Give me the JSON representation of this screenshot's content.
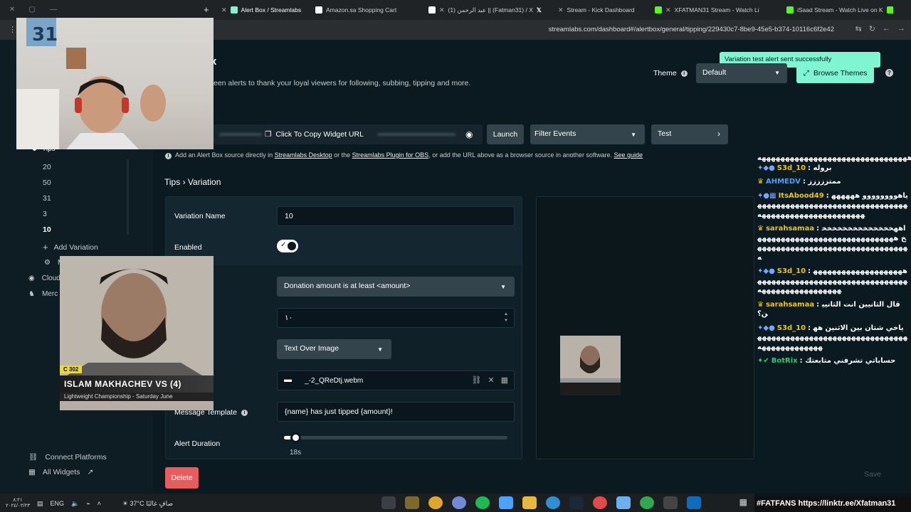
{
  "browser": {
    "tabs": [
      {
        "label": "Alert Box / Streamlabs",
        "active": true
      },
      {
        "label": "Amazon.sa Shopping Cart"
      },
      {
        "label": "(1) عبد الرحمن || (Fatman31) / X"
      },
      {
        "label": "Stream - Kick Dashboard"
      },
      {
        "label": "XFATMAN31 Stream - Watch Li"
      },
      {
        "label": "iSaad Stream - Watch Live on K"
      }
    ],
    "url": "streamlabs.com/dashboard#/alertbox/general/tipping/229430c7-8be9-45e5-b374-10116c6f2e42"
  },
  "header": {
    "title_fragment": "x",
    "description": "een alerts to thank your loyal viewers for following, subbing, tipping and more.",
    "theme_label": "Theme",
    "theme_value": "Default",
    "browse_themes": "Browse Themes",
    "toast": "Variation test alert sent successfully"
  },
  "widget_bar": {
    "copy_url": "Click To Copy Widget URL",
    "launch": "Launch",
    "filter_events": "Filter Events",
    "test": "Test",
    "info_prefix": "Add an Alert Box source directly in ",
    "info_link1": "Streamlabs Desktop",
    "info_mid1": " or the ",
    "info_link2": "Streamlabs Plugin for OBS",
    "info_mid2": ", or add the URL above as a browser source in another software. ",
    "info_link3": "See guide"
  },
  "sidebar": {
    "section": "Tips",
    "variations": [
      "20",
      "50",
      "31",
      "3",
      "10"
    ],
    "active_variation": "10",
    "add_variation": "Add Variation",
    "manage_fragment": "M",
    "cloud_fragment": "Cloud",
    "merch_fragment": "Merc",
    "connect_platforms": "Connect Platforms",
    "all_widgets": "All Widgets"
  },
  "breadcrumb": {
    "parent": "Tips",
    "sep": "›",
    "current": "Variation"
  },
  "form": {
    "variation_name_label": "Variation Name",
    "variation_name_value": "10",
    "enabled_label": "Enabled",
    "enabled": true,
    "condition": "Donation amount is at least <amount>",
    "amount": "١٠",
    "layout": "Text Over Image",
    "file_name": "_-2_QReDtj.webm",
    "message_template_label": "Message Template",
    "message_template": "{name} has just tipped {amount}!",
    "alert_duration_label": "Alert Duration",
    "alert_duration_value": "18s",
    "alert_duration_fraction": 0.05
  },
  "actions": {
    "delete": "Delete",
    "save": "Save"
  },
  "chat": [
    {
      "user": "",
      "msg": "ههههههههههههههههههههههههههههههههه"
    },
    {
      "badges": "",
      "user": "S3d_10",
      "user_color": "#f1c40f",
      "msg": ": بروله"
    },
    {
      "badges": "",
      "user": "AHMEDV",
      "user_color": "#4aa3ff",
      "msg": ": ممتززززز"
    },
    {
      "badges": "",
      "user": "ItsAbood49",
      "user_color": "#f1c40f",
      "msg": ": ياهوووووووو ههههههههههههههههههههههههههههههههههههههههههههههههههههههههههههه"
    },
    {
      "badges": "",
      "user": "sarahsamaa",
      "user_color": "#f1c40f",
      "msg": ": اههخخخخخخخخخخخخخخخ ههههههههههههههههههههههههههههههههههههههههههههههههههههههههههههههه"
    },
    {
      "badges": "",
      "user": "S3d_10",
      "user_color": "#f1c40f",
      "msg": ": هههههههههههههههههههههههههههههههههههههههههههههههههههههههههههههههههههههه"
    },
    {
      "badges": "",
      "user": "sarahsamaa",
      "user_color": "#f1c40f",
      "msg": ": قال الثانيين انت الثانيين؟"
    },
    {
      "badges": "",
      "user": "S3d_10",
      "user_color": "#f1c40f",
      "msg": ": ياخي شتان بين الاثنين هههههههههههههههههههههههههههههههههههههههههههههههه"
    },
    {
      "badges": "",
      "user": "BotRix",
      "user_color": "#2ecc71",
      "msg": ": حساباتي تشرفني متابعتك"
    }
  ],
  "banner": "#FATFANS https://linktr.ee/Xfatman31",
  "webcam2": {
    "tag": "C 302",
    "headline": "ISLAM MAKHACHEV VS (4)",
    "sub": "Lightweight Championship - Saturday June"
  },
  "taskbar": {
    "time": "٨:٢١",
    "date": "٢٠٢٤/٠٢/٢٣",
    "lang": "ENG",
    "weather": "37°C صافٍ غالبًا"
  },
  "colors": {
    "accent": "#80f5d2",
    "delete": "#e75d5d",
    "panel": "#34444c"
  }
}
